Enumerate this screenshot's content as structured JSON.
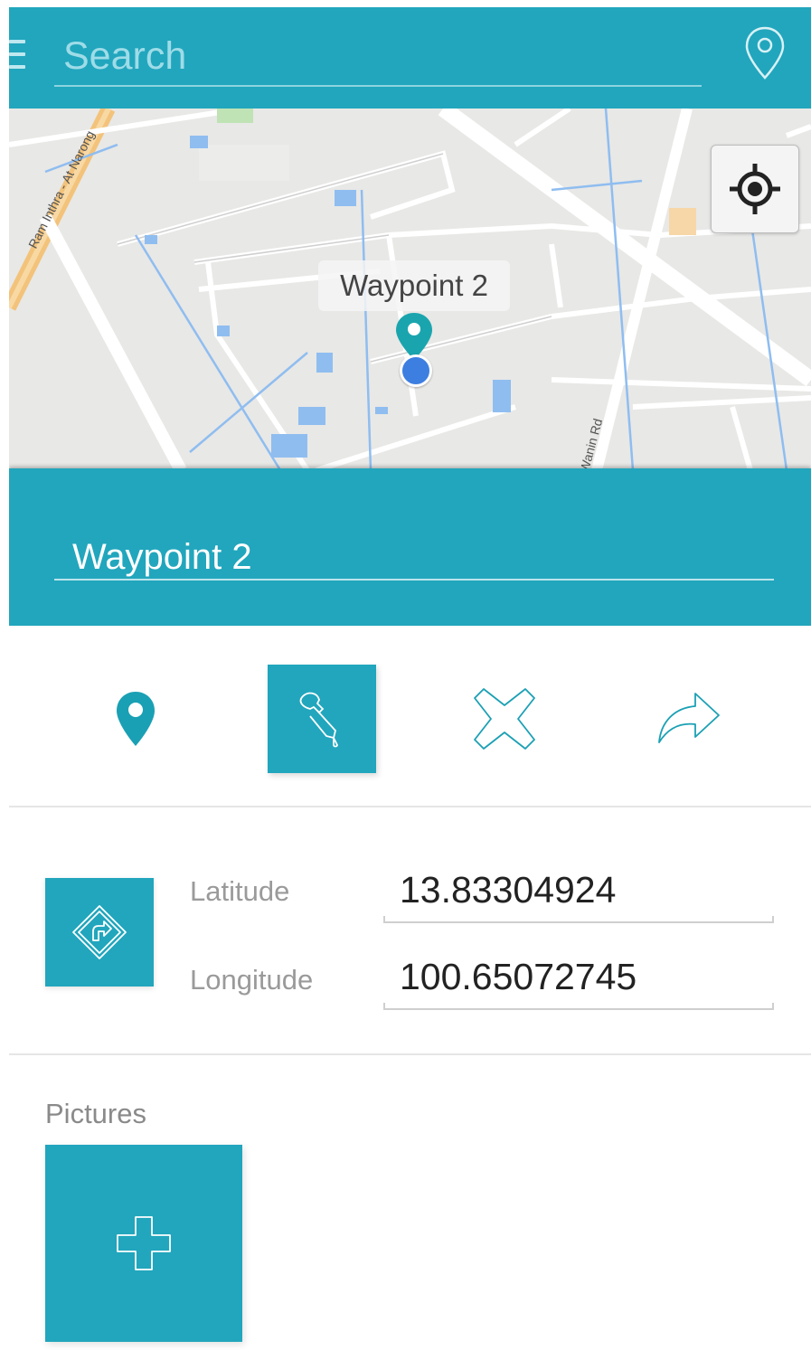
{
  "search": {
    "placeholder": "Search",
    "value": ""
  },
  "map": {
    "marker_label": "Waypoint 2",
    "street_labels": [
      "Ram Inthra - At Narong",
      "Wanin Rd"
    ]
  },
  "waypoint": {
    "name": "Waypoint 2"
  },
  "actions": [
    {
      "icon": "map-pin-icon",
      "active": false
    },
    {
      "icon": "eyedropper-icon",
      "active": true
    },
    {
      "icon": "delete-x-icon",
      "active": false
    },
    {
      "icon": "share-arrow-icon",
      "active": false
    }
  ],
  "coordinates": {
    "latitude_label": "Latitude",
    "latitude_value": "13.83304924",
    "longitude_label": "Longitude",
    "longitude_value": "100.65072745"
  },
  "pictures": {
    "label": "Pictures"
  },
  "colors": {
    "accent": "#21a6bd",
    "location_dot": "#3d7fe0",
    "map_bg": "#e8e8e6"
  }
}
